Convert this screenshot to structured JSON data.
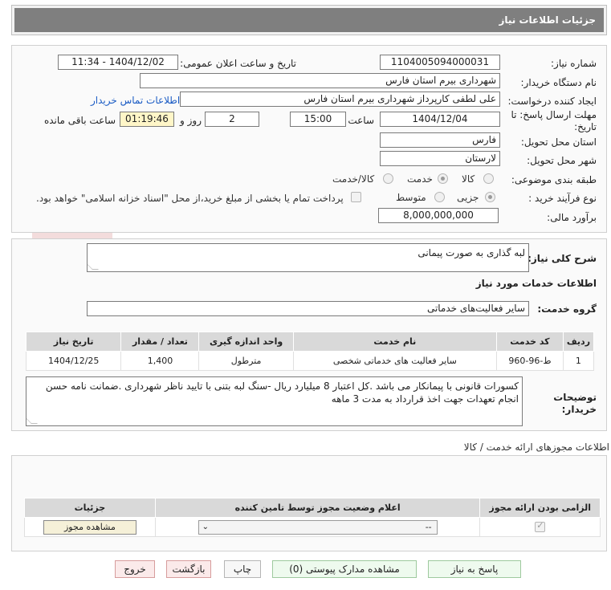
{
  "header": {
    "title": "جزئیات اطلاعات نیاز"
  },
  "form": {
    "need_number": {
      "label": "شماره نیاز:",
      "value": "1104005094000031"
    },
    "announce_datetime": {
      "label": "تاریخ و ساعت اعلان عمومی:",
      "value": "1404/12/02 - 11:34"
    },
    "buyer_org": {
      "label": "نام دستگاه خریدار:",
      "value": "شهرداری بیرم استان فارس"
    },
    "requester": {
      "label": "ایجاد کننده درخواست:",
      "value": "علی لطفی کارپرداز شهرداری بیرم استان فارس",
      "contact_link": "اطلاعات تماس خریدار"
    },
    "deadline": {
      "label": "مهلت ارسال پاسخ: تا تاریخ:",
      "date": "1404/12/04",
      "time_label": "ساعت",
      "time": "15:00",
      "days": "2",
      "days_label": "روز و",
      "remaining": "01:19:46",
      "remaining_label": "ساعت باقی مانده"
    },
    "delivery_province": {
      "label": "استان محل تحویل:",
      "value": "فارس"
    },
    "delivery_city": {
      "label": "شهر محل تحویل:",
      "value": "لارستان"
    },
    "category": {
      "label": "طبقه بندی موضوعی:",
      "options": [
        "کالا",
        "خدمت",
        "کالا/خدمت"
      ],
      "selected": "خدمت"
    },
    "purchase_type": {
      "label": "نوع فرآیند خرید :",
      "options": [
        "جزیی",
        "متوسط"
      ],
      "selected": "جزیی",
      "payment_note": "پرداخت تمام یا بخشی از مبلغ خرید،از محل \"اسناد خزانه اسلامی\" خواهد بود."
    },
    "estimate": {
      "label": "برآورد مالی:",
      "value": "8,000,000,000"
    }
  },
  "description": {
    "label": "شرح کلی نیاز:",
    "value": "لبه گذاری به صورت پیمانی"
  },
  "services": {
    "title": "اطلاعات خدمات مورد نیاز",
    "group_label": "گروه خدمت:",
    "group_value": "سایر فعالیت‌های خدماتی",
    "columns": [
      "ردیف",
      "کد خدمت",
      "نام خدمت",
      "واحد اندازه گیری",
      "تعداد / مقدار",
      "تاریخ نیاز"
    ],
    "rows": [
      [
        "1",
        "ط-96-960",
        "سایر فعالیت های خدماتی شخصی",
        "مترطول",
        "1,400",
        "1404/12/25"
      ]
    ]
  },
  "buyer_notes": {
    "label": "توضیحات خریدار:",
    "value": "کسورات قانونی با پیمانکار می باشد .کل اعتبار 8 میلیارد ریال -سنگ لبه بتنی با تایید ناظر شهرداری .ضمانت نامه حسن انجام تعهدات جهت اخذ قرارداد به مدت 3 ماهه"
  },
  "permits": {
    "title": "اطلاعات مجوزهای ارائه خدمت / کالا",
    "columns": [
      "الزامی بودن ارائه مجوز",
      "اعلام وضعیت مجوز توسط تامین کننده",
      "جزئیات"
    ],
    "select_value": "--",
    "view_button": "مشاهده مجوز"
  },
  "buttons": {
    "reply": "پاسخ به نیاز",
    "docs": "مشاهده مدارک پیوستی (0)",
    "print": "چاپ",
    "back": "بازگشت",
    "exit": "خروج"
  },
  "colors": {
    "header": "#7f7f7f",
    "link": "#1a5bc4",
    "remaining_bg": "#fff6c8"
  }
}
